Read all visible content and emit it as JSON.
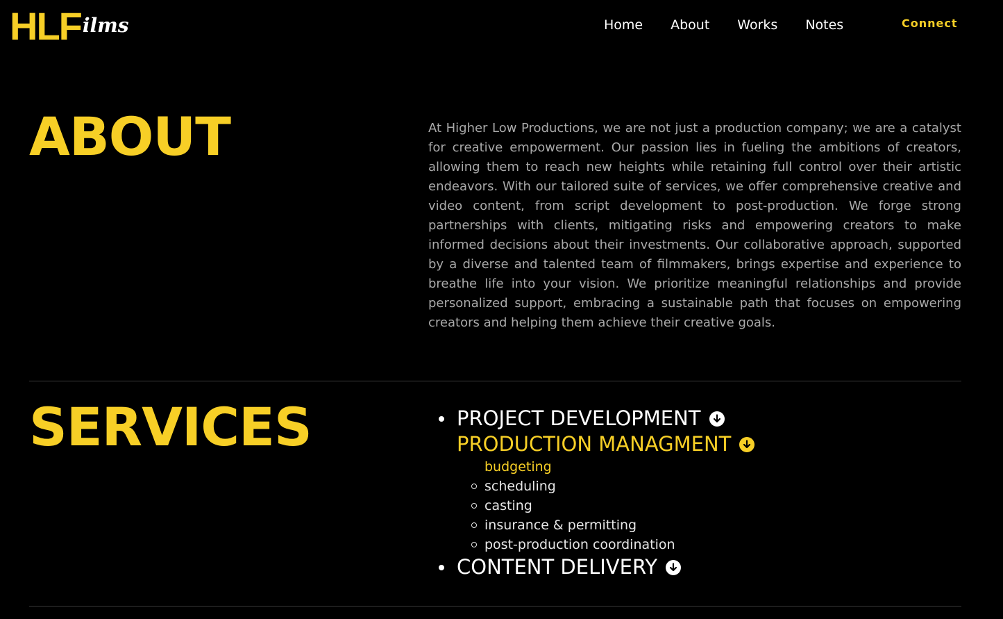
{
  "brand": {
    "logo_main": "HLF",
    "logo_sub": "ilms"
  },
  "nav": {
    "items": [
      {
        "label": "Home"
      },
      {
        "label": "About"
      },
      {
        "label": "Works"
      },
      {
        "label": "Notes"
      }
    ],
    "connect_label": "Connect"
  },
  "about": {
    "heading": "ABOUT",
    "body": "At Higher Low Productions, we are not just a production company; we are a catalyst for creative empowerment. Our passion lies in fueling the ambitions of creators, allowing them to reach new heights while retaining full control over their artistic endeavors. With our tailored suite of services, we offer comprehensive creative and video content, from script development to post-production. We forge strong partnerships with clients, mitigating risks and empowering creators to make informed decisions about their investments. Our collaborative approach, supported by a diverse and talented team of filmmakers, brings expertise and experience to breathe life into your vision. We prioritize meaningful relationships and provide personalized support, embracing a sustainable path that focuses on empowering creators and helping them achieve their creative goals."
  },
  "services": {
    "heading": "SERVICES",
    "items": [
      {
        "label": "PROJECT DEVELOPMENT",
        "icon": "arrow-down-circle-icon"
      },
      {
        "label": "PRODUCTION MANAGMENT",
        "icon": "arrow-down-circle-icon",
        "sub_items": [
          {
            "label": "budgeting"
          },
          {
            "label": "scheduling"
          },
          {
            "label": "casting"
          },
          {
            "label": "insurance & permitting"
          },
          {
            "label": "post-production coordination"
          }
        ]
      },
      {
        "label": "CONTENT DELIVERY",
        "icon": "arrow-down-circle-icon"
      }
    ]
  },
  "colors": {
    "accent": "#f7cf26",
    "background": "#000000",
    "body_text": "#a9a9a9"
  }
}
